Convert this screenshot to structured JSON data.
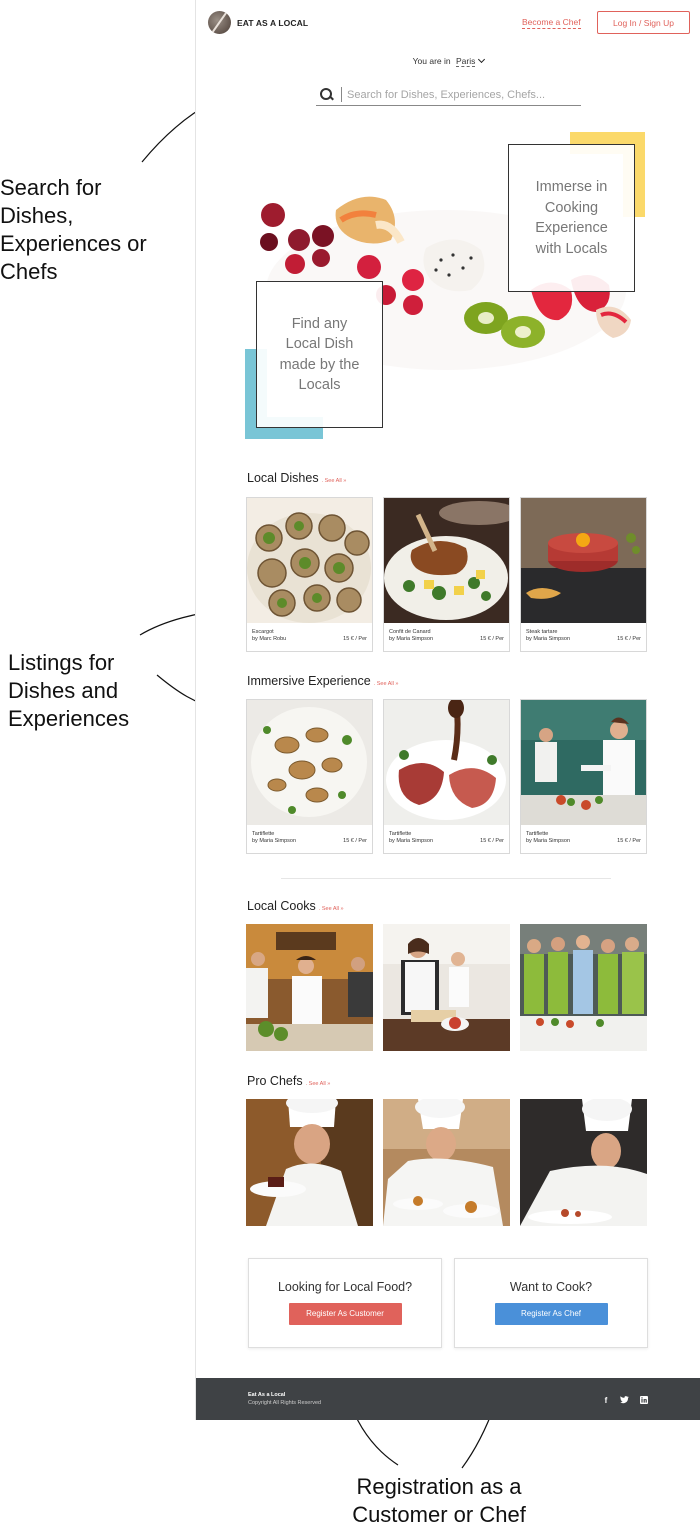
{
  "annotations": {
    "search": [
      "Search for",
      "Dishes,",
      "Experiences or",
      "Chefs"
    ],
    "listings": [
      "Listings for",
      "Dishes and",
      "Experiences"
    ],
    "registration": [
      "Registration as a",
      "Customer or Chef"
    ]
  },
  "header": {
    "brand": "EAT AS A LOCAL",
    "become_chef": "Become a Chef",
    "login": "Log In / Sign Up"
  },
  "location": {
    "prefix": "You are in",
    "city": "Paris"
  },
  "search": {
    "placeholder": "Search for Dishes, Experiences, Chefs..."
  },
  "hero": {
    "right_text": "Immerse in Cooking Experience with Locals",
    "left_text": "Find any Local Dish made by the Locals"
  },
  "sections": {
    "local_dishes": {
      "title": "Local Dishes",
      "see_all": ". See All »",
      "cards": [
        {
          "name": "Escargot",
          "by": "by Marc Robu",
          "price": "15 € / Per"
        },
        {
          "name": "Confit de Canard",
          "by": "by Maria Simpson",
          "price": "15 € / Per"
        },
        {
          "name": "Steak tartare",
          "by": "by Maria Simpson",
          "price": "15 € / Per"
        }
      ]
    },
    "immersive": {
      "title": "Immersive Experience",
      "see_all": ". See All »",
      "cards": [
        {
          "name": "Tartiflette",
          "by": "by Maria Simpson",
          "price": "15 € / Per"
        },
        {
          "name": "Tartiflette",
          "by": "by Maria Simpson",
          "price": "15 € / Per"
        },
        {
          "name": "Tartiflette",
          "by": "by Maria Simpson",
          "price": "15 € / Per"
        }
      ]
    },
    "local_cooks": {
      "title": "Local Cooks",
      "see_all": ". See All »"
    },
    "pro_chefs": {
      "title": "Pro Chefs",
      "see_all": ". See All »"
    }
  },
  "register": {
    "customer": {
      "title": "Looking for Local Food?",
      "button": "Register As Customer"
    },
    "chef": {
      "title": "Want to Cook?",
      "button": "Register As Chef"
    }
  },
  "footer": {
    "brand": "Eat As a Local",
    "copyright": "Copyright All Rights Reserved",
    "social": [
      "facebook-icon",
      "twitter-icon",
      "linkedin-icon"
    ]
  },
  "colors": {
    "accent": "#e0625b",
    "chef_button": "#4a90d9",
    "footer_bg": "#3f4245",
    "yellow": "#fbd96a",
    "blue": "#79c5d6"
  }
}
